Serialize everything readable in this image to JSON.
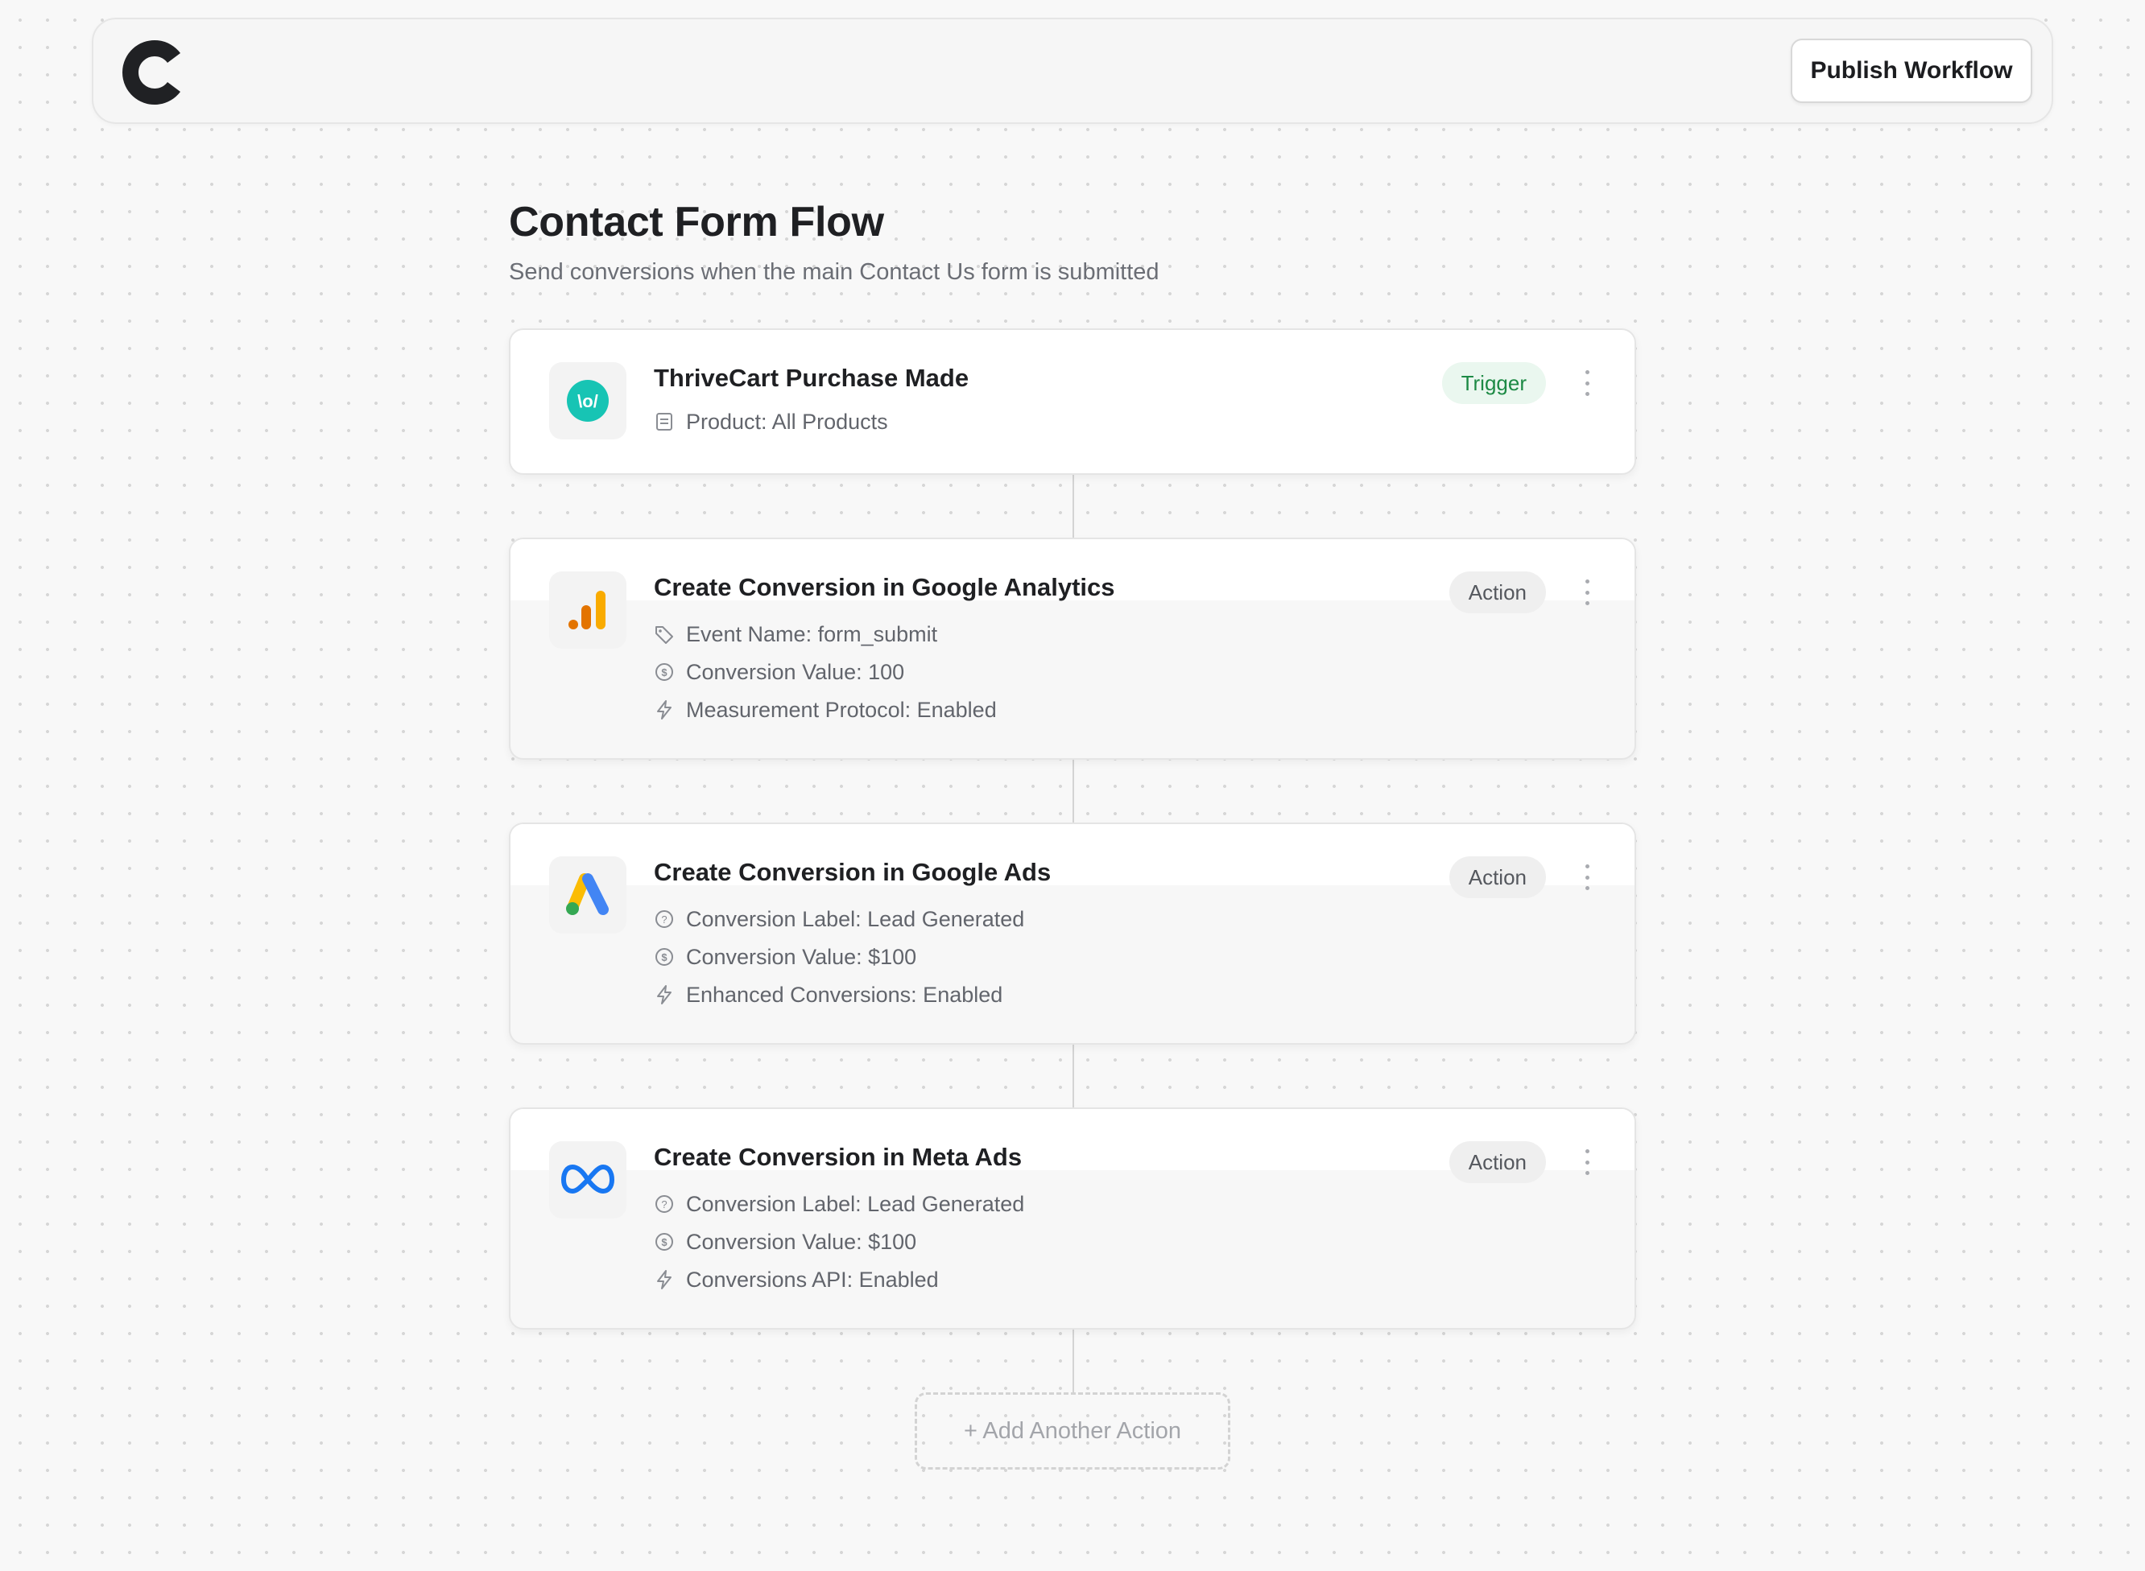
{
  "header": {
    "logo_icon": "brand-c-logo",
    "publish_label": "Publish Workflow"
  },
  "workflow": {
    "title": "Contact Form Flow",
    "subtitle": "Send conversions when the main Contact Us form is submitted",
    "add_action_label": "+ Add Another Action"
  },
  "steps": [
    {
      "app": "thrivecart",
      "icon": "thrivecart-icon",
      "title": "ThriveCart Purchase Made",
      "badge": "Trigger",
      "details": [
        {
          "icon": "document-icon",
          "text": "Product: All Products"
        }
      ]
    },
    {
      "app": "google-analytics",
      "icon": "google-analytics-icon",
      "title": "Create Conversion in Google Analytics",
      "badge": "Action",
      "details": [
        {
          "icon": "tag-icon",
          "text": "Event Name: form_submit"
        },
        {
          "icon": "dollar-circle-icon",
          "text": "Conversion Value: 100"
        },
        {
          "icon": "lightning-icon",
          "text": "Measurement Protocol: Enabled"
        }
      ]
    },
    {
      "app": "google-ads",
      "icon": "google-ads-icon",
      "title": "Create Conversion in Google Ads",
      "badge": "Action",
      "details": [
        {
          "icon": "question-circle-icon",
          "text": "Conversion Label: Lead Generated"
        },
        {
          "icon": "dollar-circle-icon",
          "text": "Conversion Value: $100"
        },
        {
          "icon": "lightning-icon",
          "text": "Enhanced Conversions: Enabled"
        }
      ]
    },
    {
      "app": "meta-ads",
      "icon": "meta-icon",
      "title": "Create Conversion in Meta Ads",
      "badge": "Action",
      "details": [
        {
          "icon": "question-circle-icon",
          "text": "Conversion Label: Lead Generated"
        },
        {
          "icon": "dollar-circle-icon",
          "text": "Conversion Value: $100"
        },
        {
          "icon": "lightning-icon",
          "text": "Conversions API: Enabled"
        }
      ]
    }
  ],
  "colors": {
    "thrivecart": "#17c4b4",
    "ga_dark": "#e37400",
    "ga_light": "#f9ab00",
    "ads_blue": "#4285f4",
    "ads_yellow": "#fbbc04",
    "ads_green": "#34a853",
    "meta_blue": "#1877f2",
    "trigger_green": "#1d8a45"
  }
}
